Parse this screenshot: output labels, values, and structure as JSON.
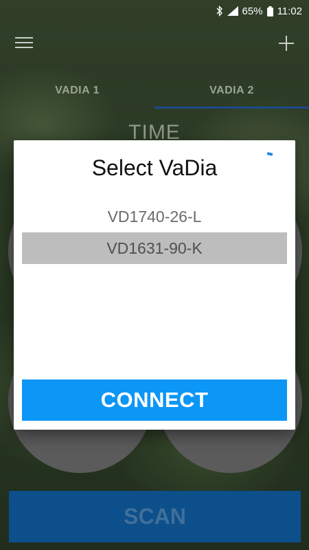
{
  "status_bar": {
    "battery": "65%",
    "time": "11:02"
  },
  "app_bar": {
    "menu_icon": "hamburger-menu-icon",
    "add_icon": "plus-icon"
  },
  "tabs": [
    {
      "label": "VADIA 1",
      "active": false
    },
    {
      "label": "VADIA 2",
      "active": true
    }
  ],
  "background": {
    "section_title": "TIME",
    "scan_label": "SCAN"
  },
  "dialog": {
    "title": "Select VaDia",
    "devices": [
      {
        "label": "VD1740-26-L",
        "selected": false
      },
      {
        "label": "VD1631-90-K",
        "selected": true
      }
    ],
    "connect_label": "CONNECT"
  },
  "colors": {
    "connect_button": "#0c96f6",
    "selected_row": "#bdbdbd",
    "active_tab_indicator": "#1c4a8a",
    "scan_button": "#0d4f8a"
  }
}
